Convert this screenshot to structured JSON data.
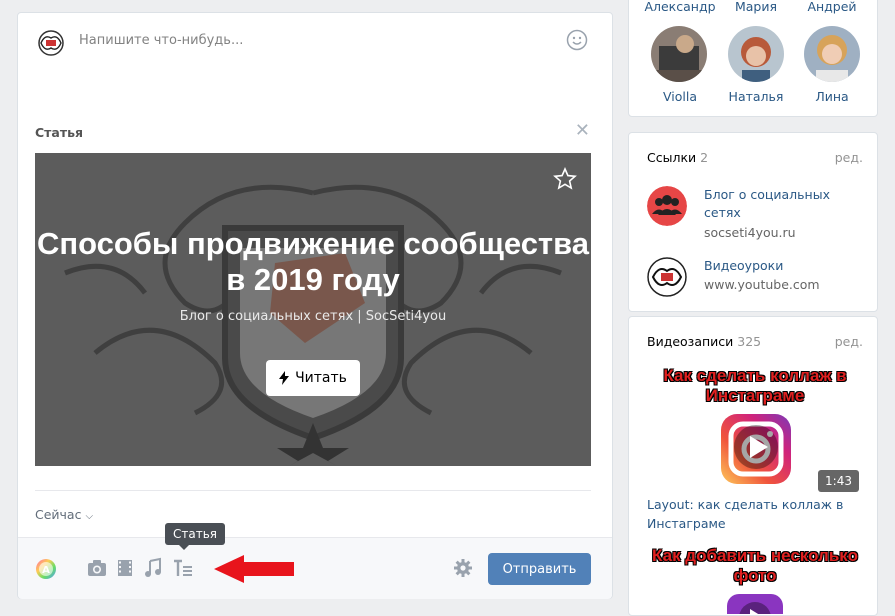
{
  "composer": {
    "placeholder": "Напишите что-нибудь...",
    "attachment_label": "Статья",
    "article": {
      "title": "Способы продвижение сообщества в 2019 году",
      "source": "Блог о социальных сетях | SocSeti4you",
      "read_button": "Читать"
    },
    "publish_time": "Сейчас",
    "tooltip": "Статья",
    "send_button": "Отправить",
    "toolbar_icons": [
      "photo-icon",
      "video-icon",
      "music-icon",
      "article-icon",
      "settings-icon"
    ]
  },
  "friends": {
    "top_names": [
      "Александр",
      "Мария",
      "Андрей"
    ],
    "items": [
      {
        "name": "Violla"
      },
      {
        "name": "Наталья"
      },
      {
        "name": "Лина"
      }
    ]
  },
  "links": {
    "title": "Ссылки",
    "count": "2",
    "edit": "ред.",
    "items": [
      {
        "title": "Блог о социальных сетях",
        "url": "socseti4you.ru"
      },
      {
        "title": "Видеоуроки",
        "url": "www.youtube.com"
      }
    ]
  },
  "videos": {
    "title": "Видеозаписи",
    "count": "325",
    "edit": "ред.",
    "items": [
      {
        "thumb_text": "Как сделать коллаж в Инстаграме",
        "duration": "1:43",
        "caption": "Layout: как сделать коллаж в Инстаграме"
      },
      {
        "thumb_text": "Как добавить несколько фото"
      }
    ]
  },
  "colors": {
    "accent": "#5181b8",
    "link": "#2a5885",
    "arrow": "#e8141c"
  }
}
